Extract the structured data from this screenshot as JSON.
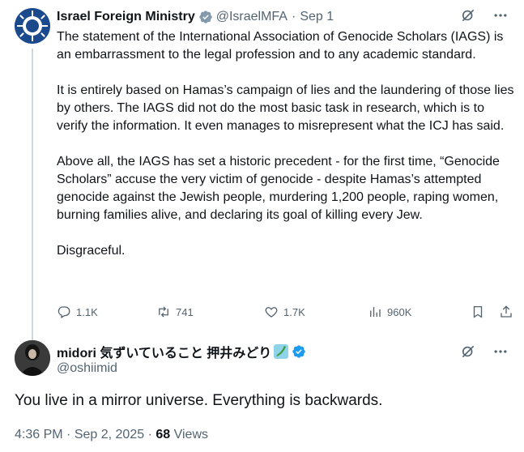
{
  "colors": {
    "text": "#0f1419",
    "secondary": "#536471",
    "verified": "#1d9bf0",
    "gold_badge": "#e2b719",
    "thread_line": "#cfd9de"
  },
  "tweet": {
    "author_name": "Israel Foreign Ministry",
    "verified_badge": "verified-org-badge",
    "handle": "@IsraelMFA",
    "separator": "·",
    "date": "Sep 1",
    "paragraphs": [
      "The statement of the International Association of Genocide Scholars (IAGS) is an embarrassment to the legal profession and to any academic standard.",
      "It is entirely based on Hamas’s campaign of lies and the laundering of those lies by others. The IAGS did not do the most basic task in research, which is to verify the information. It even manages to misrepresent what the ICJ has said.",
      "Above all, the IAGS has set a historic precedent - for the first time, “Genocide Scholars” accuse the very victim of genocide - despite Hamas’s attempted genocide against the Jewish people, murdering 1,200 people, raping women, burning families alive, and declaring its goal of killing every Jew.",
      "Disgraceful."
    ],
    "stats": {
      "replies": "1.1K",
      "reposts": "741",
      "likes": "1.7K",
      "views": "960K"
    },
    "icons": [
      "grok-icon",
      "more-icon",
      "reply-icon",
      "repost-icon",
      "like-icon",
      "views-icon",
      "bookmark-icon",
      "share-icon"
    ]
  },
  "reply": {
    "author_name": "midori 気ずいていること 押井みどり",
    "handle": "@oshiimid",
    "text": "You live in a mirror universe. Everything is backwards.",
    "time": "4:36 PM",
    "separator": "·",
    "date": "Sep 2, 2025",
    "separator2": "·",
    "views_count": "68",
    "views_label": "Views",
    "icons": [
      "japan-map-emoji-icon",
      "verified-icon",
      "grok-icon",
      "more-icon"
    ]
  }
}
